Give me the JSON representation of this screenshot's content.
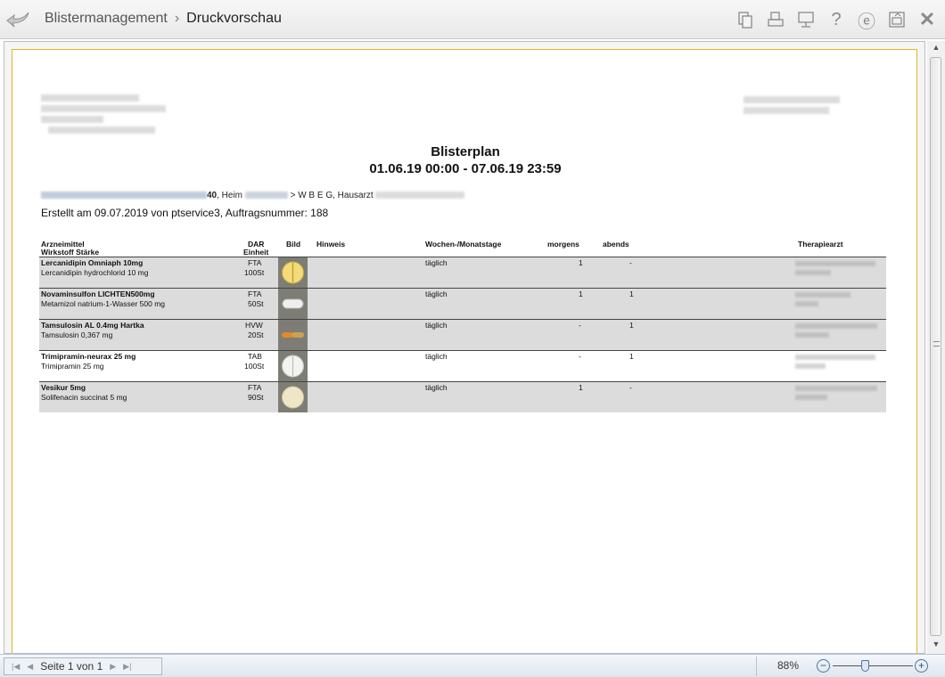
{
  "titlebar": {
    "breadcrumb_1": "Blistermanagement",
    "breadcrumb_sep": "›",
    "breadcrumb_2": "Druckvorschau",
    "tools": [
      "copy-icon",
      "printer-icon",
      "monitor-icon",
      "help-icon",
      "e-icon",
      "export-icon",
      "close-icon"
    ],
    "help_glyph": "?",
    "e_glyph": "ⓔ",
    "close_glyph": "✕"
  },
  "document": {
    "title": "Blisterplan",
    "period": "01.06.19 00:00 - 07.06.19 23:59",
    "patient_line_fragment_1": "40",
    "patient_line_fragment_2": ", Heim",
    "patient_line_fragment_3": "> W B E G, Hausarzt",
    "created_line": "Erstellt am 09.07.2019 von  ptservice3, Auftragsnummer: 188",
    "headers": {
      "arzneimittel": "Arzneimittel",
      "wirkstoff": "Wirkstoff Stärke",
      "dar": "DAR",
      "einheit": "Einheit",
      "bild": "Bild",
      "hinweis": "Hinweis",
      "wochen": "Wochen-/Monatstage",
      "morgens": "morgens",
      "abends": "abends",
      "therapiearzt": "Therapiearzt"
    },
    "rows": [
      {
        "name": "Lercanidipin Omniaph 10mg",
        "substance": "Lercanidipin hydrochlorid 10 mg",
        "dar": "FTA",
        "unit": "100St",
        "pill": "yellow-round",
        "days": "täglich",
        "morning": "1",
        "evening": "-"
      },
      {
        "name": "Novaminsulfon LICHTEN500mg",
        "substance": "Metamizol natrium-1-Wasser 500 mg",
        "dar": "FTA",
        "unit": "50St",
        "pill": "white-oblong",
        "days": "täglich",
        "morning": "1",
        "evening": "1"
      },
      {
        "name": "Tamsulosin AL 0.4mg Hartka",
        "substance": "Tamsulosin 0,367 mg",
        "dar": "HVW",
        "unit": "20St",
        "pill": "orange-capsule",
        "days": "täglich",
        "morning": "-",
        "evening": "1"
      },
      {
        "name": "Trimipramin-neurax 25 mg",
        "substance": "Trimipramin 25 mg",
        "dar": "TAB",
        "unit": "100St",
        "pill": "white-round-scored",
        "days": "täglich",
        "morning": "-",
        "evening": "1"
      },
      {
        "name": "Vesikur 5mg",
        "substance": "Solifenacin succinat 5 mg",
        "dar": "FTA",
        "unit": "90St",
        "pill": "cream-round",
        "days": "täglich",
        "morning": "1",
        "evening": "-"
      }
    ]
  },
  "statusbar": {
    "page_label": "Seite 1 von 1",
    "zoom": "88%",
    "zoom_level": 0.88,
    "first_glyph": "|◀",
    "prev_glyph": "◀",
    "next_glyph": "▶",
    "last_glyph": "▶|",
    "minus_glyph": "−",
    "plus_glyph": "+"
  },
  "scrollbar": {
    "up_glyph": "▲",
    "down_glyph": "▼"
  }
}
